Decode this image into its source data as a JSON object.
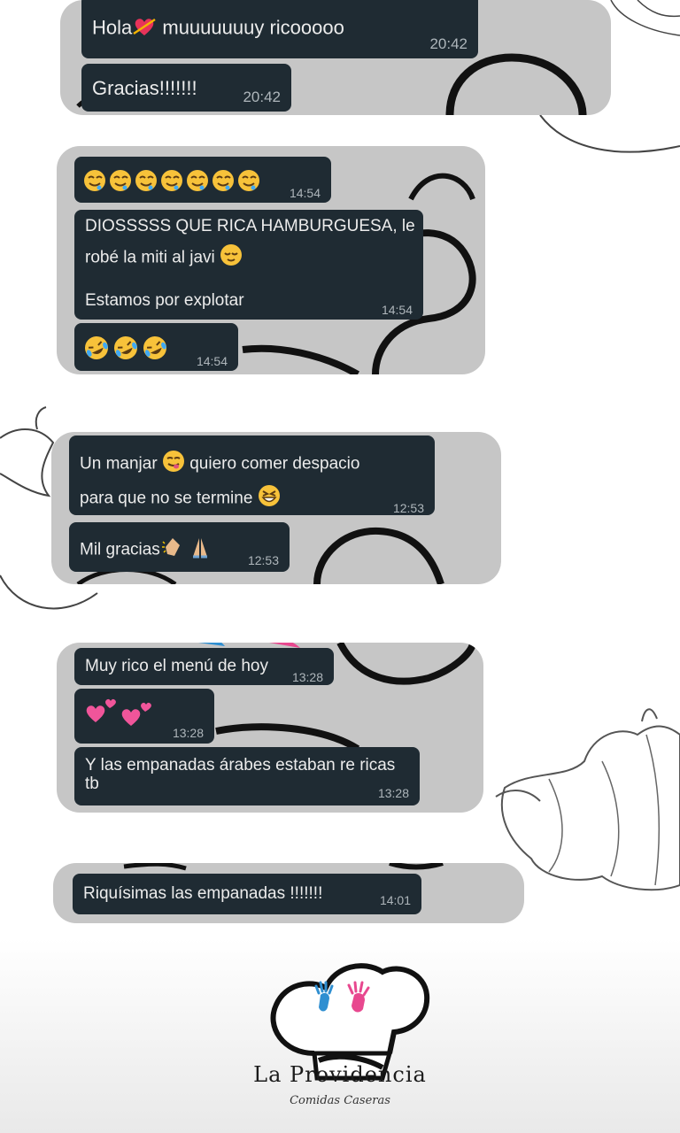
{
  "conversations": [
    {
      "messages": [
        {
          "text_a": "Hola",
          "text_b": " muuuuuuuy ricooooo",
          "time": "20:42"
        },
        {
          "text": "Gracias!!!!!!!",
          "time": "20:42"
        }
      ]
    },
    {
      "messages": [
        {
          "time": "14:54"
        },
        {
          "line1": "DIOSSSSS QUE RICA HAMBURGUESA, le",
          "line2": "robé la miti al javi",
          "line3": "Estamos por explotar",
          "time": "14:54"
        },
        {
          "time": "14:54"
        }
      ]
    },
    {
      "messages": [
        {
          "line1_a": "Un manjar",
          "line1_b": " quiero comer despacio",
          "line2": "para que no se termine",
          "time": "12:53"
        },
        {
          "text": "Mil gracias",
          "time": "12:53"
        }
      ]
    },
    {
      "messages": [
        {
          "text": "Muy rico el menú de hoy",
          "time": "13:28"
        },
        {
          "time": "13:28"
        },
        {
          "line1": "Y las empanadas árabes estaban re ricas",
          "line2": "tb",
          "time": "13:28"
        }
      ]
    },
    {
      "messages": [
        {
          "text": "Riquísimas las empanadas !!!!!!!",
          "time": "14:01"
        }
      ]
    }
  ],
  "brand": {
    "name": "La Providencia",
    "tagline": "Comidas Caseras"
  },
  "colors": {
    "bubble": "#1f2b33",
    "card": "#c6c6c6",
    "hand_blue": "#2f8fd1",
    "hand_pink": "#e8488f"
  },
  "icons": [
    "heart-arrow-emoji",
    "drooling-face-emoji",
    "relieved-face-emoji",
    "rofl-emoji",
    "savoring-face-emoji",
    "grinning-squint-emoji",
    "clapping-hands-emoji",
    "folded-hands-emoji",
    "two-hearts-emoji",
    "chef-hat-logo",
    "garlic-illustration",
    "vegetable-illustration"
  ]
}
